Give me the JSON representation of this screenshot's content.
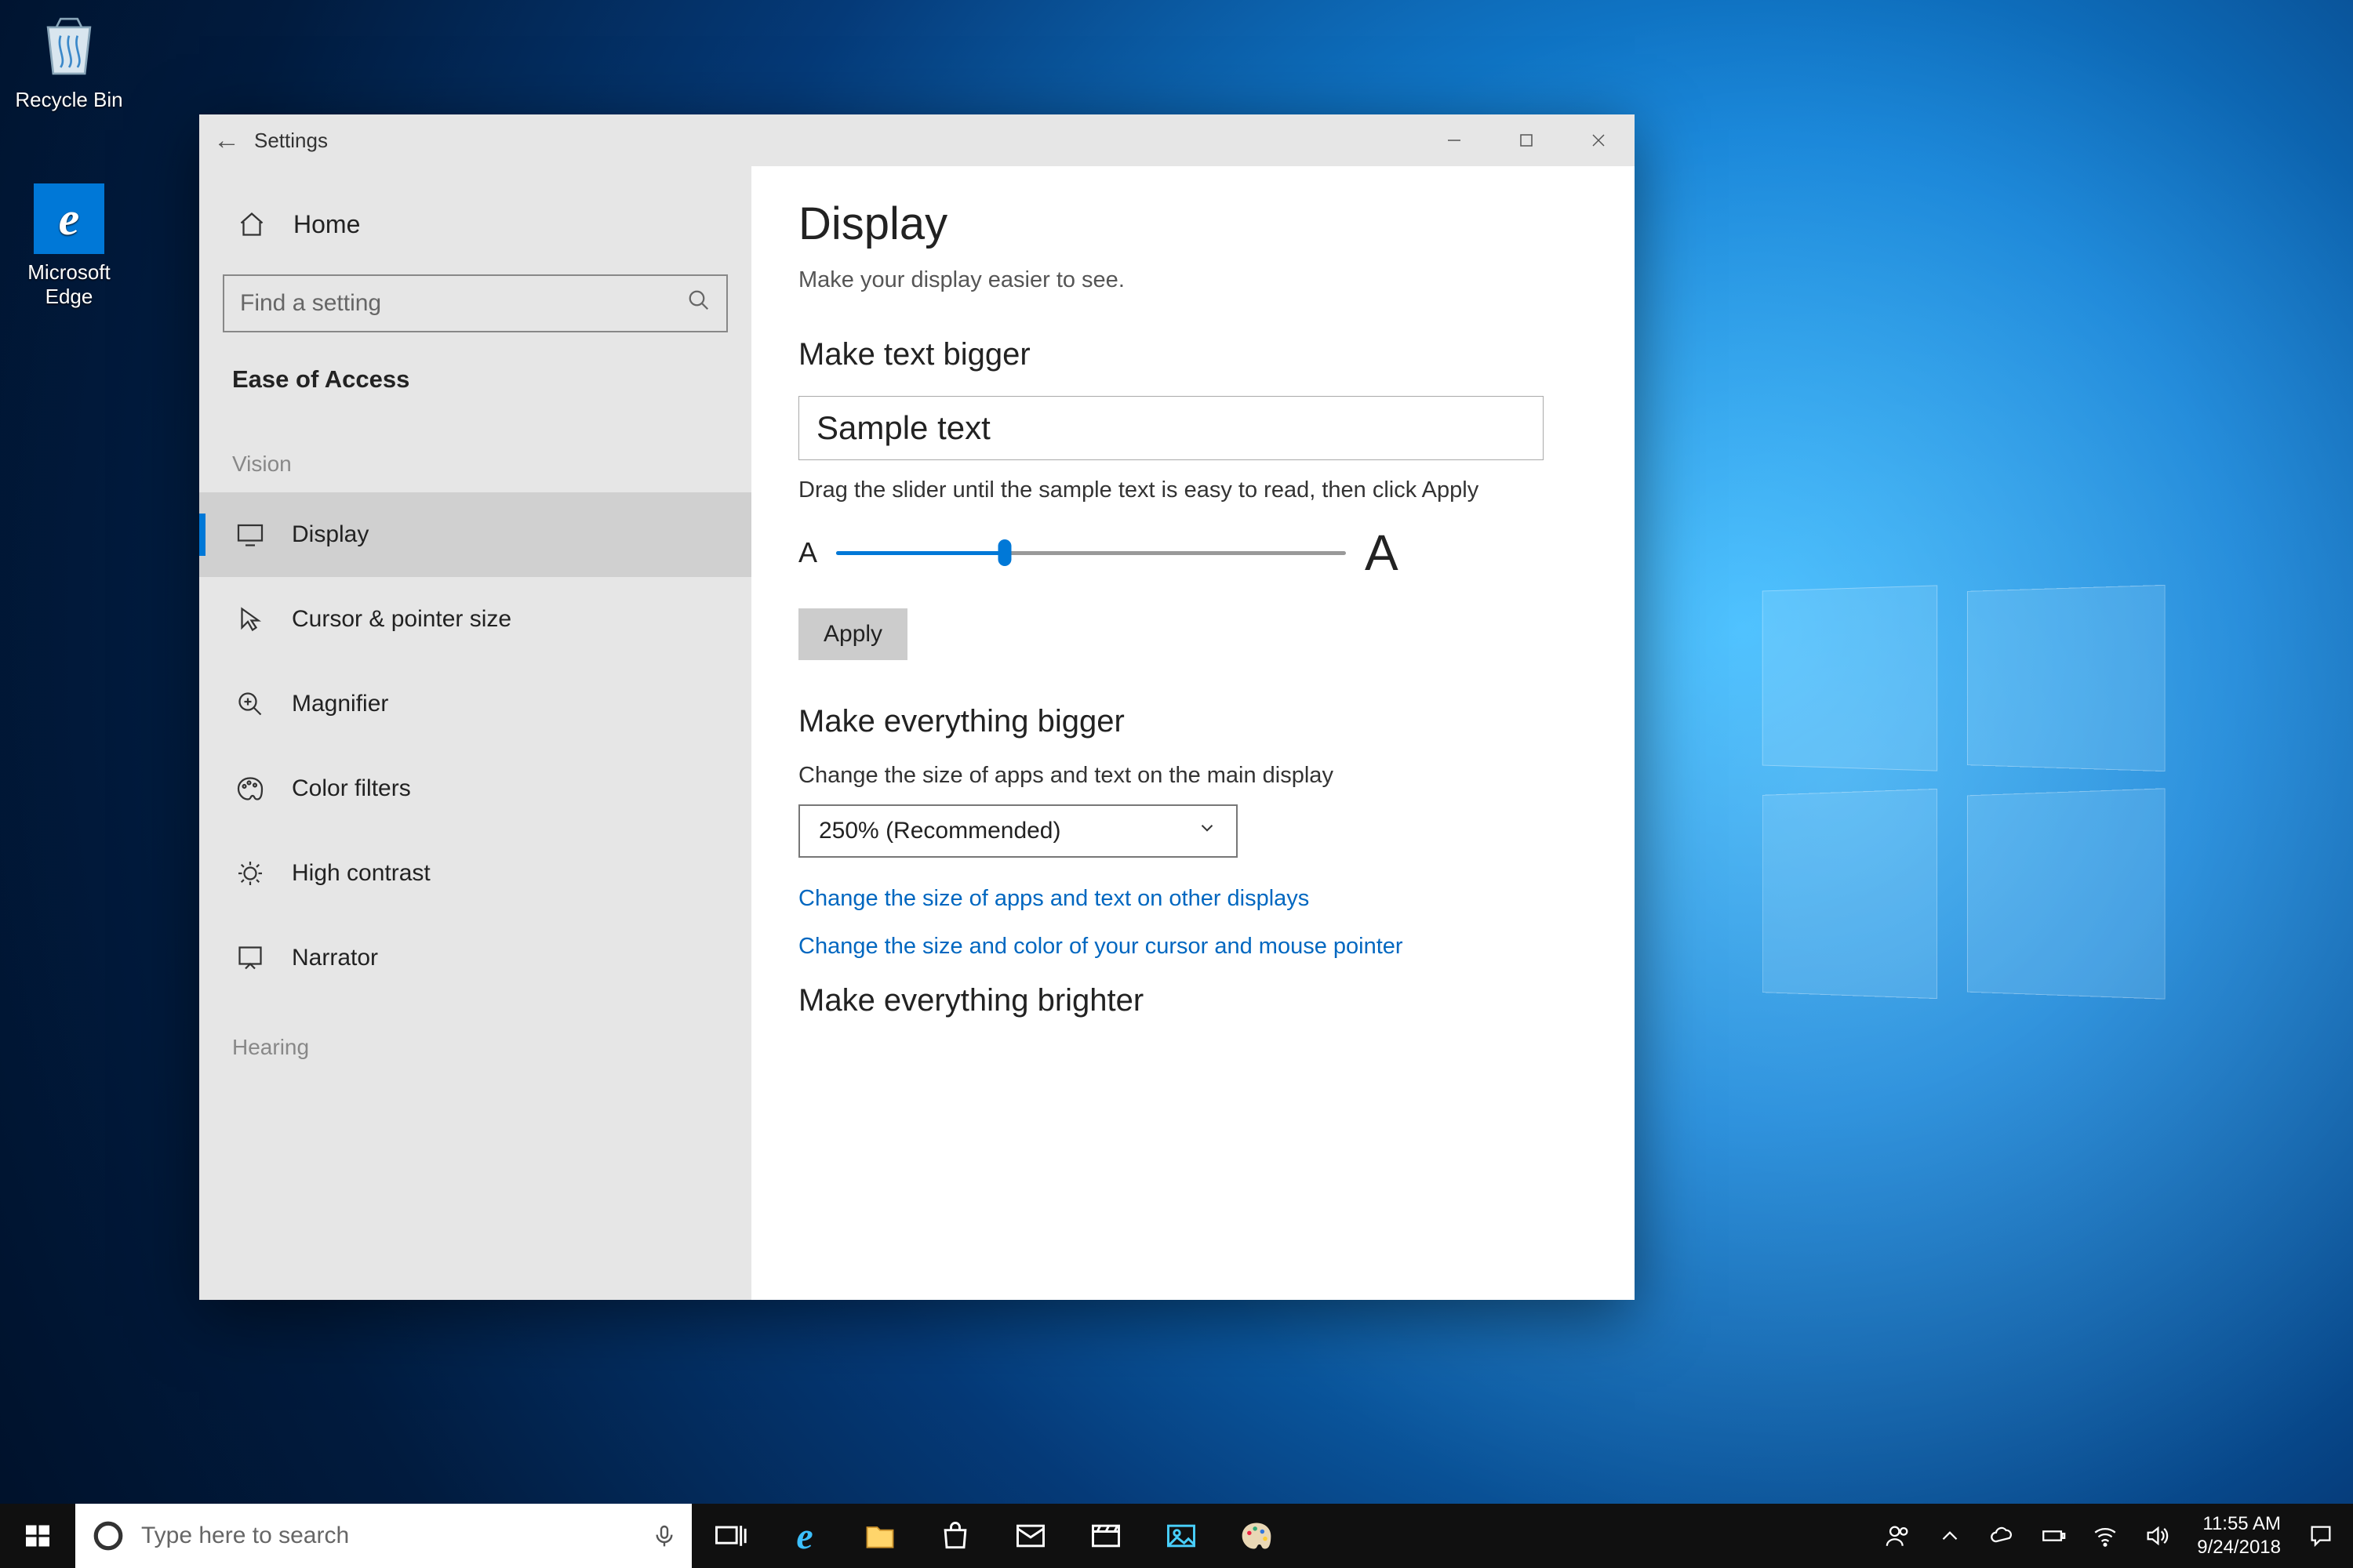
{
  "desktop": {
    "recycle_bin": "Recycle Bin",
    "edge": "Microsoft Edge"
  },
  "window": {
    "title": "Settings",
    "sidebar": {
      "home": "Home",
      "search_placeholder": "Find a setting",
      "heading": "Ease of Access",
      "cat_vision": "Vision",
      "items": [
        "Display",
        "Cursor & pointer size",
        "Magnifier",
        "Color filters",
        "High contrast",
        "Narrator"
      ],
      "cat_hearing": "Hearing"
    },
    "content": {
      "h1": "Display",
      "sub": "Make your display easier to see.",
      "s1_h2": "Make text bigger",
      "sample": "Sample text",
      "hint": "Drag the slider until the sample text is easy to read, then click Apply",
      "small_a": "A",
      "big_a": "A",
      "apply": "Apply",
      "s2_h2": "Make everything bigger",
      "s2_desc": "Change the size of apps and text on the main display",
      "scale_value": "250% (Recommended)",
      "link1": "Change the size of apps and text on other displays",
      "link2": "Change the size and color of your cursor and mouse pointer",
      "s3_h2": "Make everything brighter"
    }
  },
  "taskbar": {
    "search_placeholder": "Type here to search",
    "time": "11:55 AM",
    "date": "9/24/2018"
  }
}
